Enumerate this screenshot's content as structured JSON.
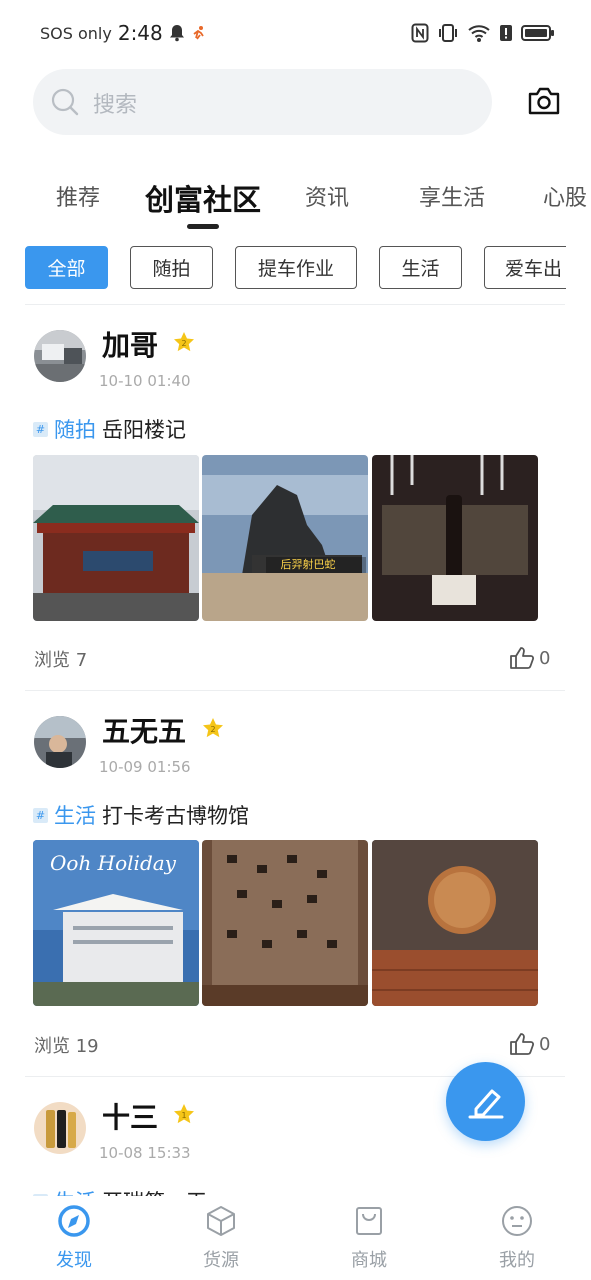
{
  "status_bar": {
    "sos": "SOS only",
    "time": "2:48",
    "icons": [
      "bell-icon",
      "runner-icon",
      "nfc-icon",
      "vibrate-icon",
      "wifi-icon",
      "alert-icon",
      "battery-icon"
    ]
  },
  "search": {
    "placeholder": "搜索"
  },
  "tabs": [
    {
      "label": "推荐"
    },
    {
      "label": "创富社区",
      "active": true
    },
    {
      "label": "资讯"
    },
    {
      "label": "享生活"
    },
    {
      "label": "心股"
    }
  ],
  "chips": [
    {
      "label": "全部",
      "active": true
    },
    {
      "label": "随拍"
    },
    {
      "label": "提车作业"
    },
    {
      "label": "生活"
    },
    {
      "label": "爱车出"
    }
  ],
  "posts": [
    {
      "author": "加哥",
      "level": "2",
      "time": "10-10 01:40",
      "tag": "随拍",
      "title": "岳阳楼记",
      "image_captions": [
        "",
        "后羿射巴蛇",
        ""
      ],
      "views_label": "浏览 7",
      "likes": "0"
    },
    {
      "author": "五无五",
      "level": "2",
      "time": "10-09 01:56",
      "tag": "生活",
      "title": "打卡考古博物馆",
      "image_captions": [
        "Ooh Holiday",
        "",
        ""
      ],
      "views_label": "浏览 19",
      "likes": "0"
    },
    {
      "author": "十三",
      "level": "1",
      "time": "10-08 15:33",
      "tag": "生活",
      "title": "开瑞第一天"
    }
  ],
  "bottom_nav": [
    {
      "label": "发现",
      "icon": "compass-icon",
      "active": true
    },
    {
      "label": "货源",
      "icon": "box-icon"
    },
    {
      "label": "商城",
      "icon": "shopping-bag-icon"
    },
    {
      "label": "我的",
      "icon": "smiley-icon"
    }
  ],
  "colors": {
    "accent": "#3a97ee",
    "badge": "#f5c518"
  }
}
